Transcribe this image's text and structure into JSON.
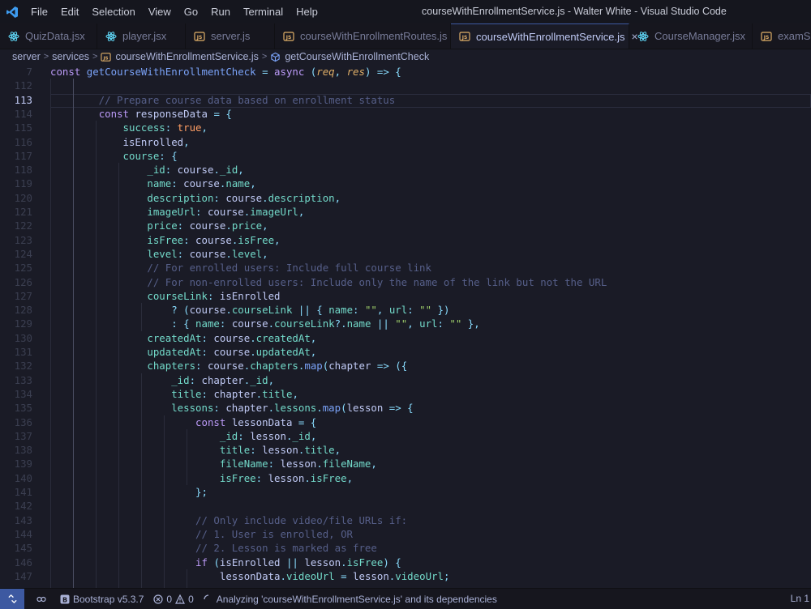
{
  "menu": [
    "File",
    "Edit",
    "Selection",
    "View",
    "Go",
    "Run",
    "Terminal",
    "Help"
  ],
  "window_title": "courseWithEnrollmentService.js - Walter White - Visual Studio Code",
  "tabs": [
    {
      "label": "QuizData.jsx",
      "icon": "react-icon",
      "active": false
    },
    {
      "label": "player.jsx",
      "icon": "react-icon",
      "active": false
    },
    {
      "label": "server.js",
      "icon": "js-icon",
      "active": false
    },
    {
      "label": "courseWithEnrollmentRoutes.js",
      "icon": "js-icon",
      "active": false
    },
    {
      "label": "courseWithEnrollmentService.js",
      "icon": "js-icon",
      "active": true
    },
    {
      "label": "CourseManager.jsx",
      "icon": "react-icon",
      "active": false
    },
    {
      "label": "examSe",
      "icon": "js-icon",
      "active": false
    }
  ],
  "tab_close": "×",
  "breadcrumb": {
    "parts": [
      "server",
      "services",
      "courseWithEnrollmentService.js",
      "getCourseWithEnrollmentCheck"
    ],
    "separator": ">"
  },
  "editor": {
    "current_line": "113",
    "lines": [
      {
        "n": "7",
        "tokens": [
          [
            "kw",
            "const "
          ],
          [
            "fn",
            "getCourseWithEnrollmentCheck"
          ],
          [
            "punc",
            " = "
          ],
          [
            "kw",
            "async "
          ],
          [
            "punc",
            "("
          ],
          [
            "param",
            "req"
          ],
          [
            "punc",
            ", "
          ],
          [
            "param",
            "res"
          ],
          [
            "punc",
            ") => {"
          ]
        ]
      },
      {
        "n": "112",
        "tokens": []
      },
      {
        "n": "113",
        "tokens": [
          [
            "cm",
            "        // Prepare course data based on enrollment status"
          ]
        ]
      },
      {
        "n": "114",
        "tokens": [
          [
            "var",
            "        "
          ],
          [
            "kw",
            "const "
          ],
          [
            "var",
            "responseData "
          ],
          [
            "punc",
            "= {"
          ]
        ]
      },
      {
        "n": "115",
        "tokens": [
          [
            "var",
            "            "
          ],
          [
            "prop",
            "success"
          ],
          [
            "punc",
            ": "
          ],
          [
            "bool",
            "true"
          ],
          [
            "punc",
            ","
          ]
        ]
      },
      {
        "n": "116",
        "tokens": [
          [
            "var",
            "            isEnrolled"
          ],
          [
            "punc",
            ","
          ]
        ]
      },
      {
        "n": "117",
        "tokens": [
          [
            "var",
            "            "
          ],
          [
            "prop",
            "course"
          ],
          [
            "punc",
            ": {"
          ]
        ]
      },
      {
        "n": "118",
        "tokens": [
          [
            "var",
            "                "
          ],
          [
            "prop",
            "_id"
          ],
          [
            "punc",
            ": "
          ],
          [
            "var",
            "course"
          ],
          [
            "punc",
            "."
          ],
          [
            "prop",
            "_id"
          ],
          [
            "punc",
            ","
          ]
        ]
      },
      {
        "n": "119",
        "tokens": [
          [
            "var",
            "                "
          ],
          [
            "prop",
            "name"
          ],
          [
            "punc",
            ": "
          ],
          [
            "var",
            "course"
          ],
          [
            "punc",
            "."
          ],
          [
            "prop",
            "name"
          ],
          [
            "punc",
            ","
          ]
        ]
      },
      {
        "n": "120",
        "tokens": [
          [
            "var",
            "                "
          ],
          [
            "prop",
            "description"
          ],
          [
            "punc",
            ": "
          ],
          [
            "var",
            "course"
          ],
          [
            "punc",
            "."
          ],
          [
            "prop",
            "description"
          ],
          [
            "punc",
            ","
          ]
        ]
      },
      {
        "n": "121",
        "tokens": [
          [
            "var",
            "                "
          ],
          [
            "prop",
            "imageUrl"
          ],
          [
            "punc",
            ": "
          ],
          [
            "var",
            "course"
          ],
          [
            "punc",
            "."
          ],
          [
            "prop",
            "imageUrl"
          ],
          [
            "punc",
            ","
          ]
        ]
      },
      {
        "n": "122",
        "tokens": [
          [
            "var",
            "                "
          ],
          [
            "prop",
            "price"
          ],
          [
            "punc",
            ": "
          ],
          [
            "var",
            "course"
          ],
          [
            "punc",
            "."
          ],
          [
            "prop",
            "price"
          ],
          [
            "punc",
            ","
          ]
        ]
      },
      {
        "n": "123",
        "tokens": [
          [
            "var",
            "                "
          ],
          [
            "prop",
            "isFree"
          ],
          [
            "punc",
            ": "
          ],
          [
            "var",
            "course"
          ],
          [
            "punc",
            "."
          ],
          [
            "prop",
            "isFree"
          ],
          [
            "punc",
            ","
          ]
        ]
      },
      {
        "n": "124",
        "tokens": [
          [
            "var",
            "                "
          ],
          [
            "prop",
            "level"
          ],
          [
            "punc",
            ": "
          ],
          [
            "var",
            "course"
          ],
          [
            "punc",
            "."
          ],
          [
            "prop",
            "level"
          ],
          [
            "punc",
            ","
          ]
        ]
      },
      {
        "n": "125",
        "tokens": [
          [
            "cm",
            "                // For enrolled users: Include full course link"
          ]
        ]
      },
      {
        "n": "126",
        "tokens": [
          [
            "cm",
            "                // For non-enrolled users: Include only the name of the link but not the URL"
          ]
        ]
      },
      {
        "n": "127",
        "tokens": [
          [
            "var",
            "                "
          ],
          [
            "prop",
            "courseLink"
          ],
          [
            "punc",
            ": "
          ],
          [
            "var",
            "isEnrolled"
          ]
        ]
      },
      {
        "n": "128",
        "tokens": [
          [
            "var",
            "                    "
          ],
          [
            "punc",
            "? ("
          ],
          [
            "var",
            "course"
          ],
          [
            "punc",
            "."
          ],
          [
            "prop",
            "courseLink"
          ],
          [
            "punc",
            " || { "
          ],
          [
            "prop",
            "name"
          ],
          [
            "punc",
            ": "
          ],
          [
            "str",
            "\"\""
          ],
          [
            "punc",
            ", "
          ],
          [
            "prop",
            "url"
          ],
          [
            "punc",
            ": "
          ],
          [
            "str",
            "\"\""
          ],
          [
            "punc",
            " })"
          ]
        ]
      },
      {
        "n": "129",
        "tokens": [
          [
            "var",
            "                    "
          ],
          [
            "punc",
            ": { "
          ],
          [
            "prop",
            "name"
          ],
          [
            "punc",
            ": "
          ],
          [
            "var",
            "course"
          ],
          [
            "punc",
            "."
          ],
          [
            "prop",
            "courseLink"
          ],
          [
            "punc",
            "?."
          ],
          [
            "prop",
            "name"
          ],
          [
            "punc",
            " || "
          ],
          [
            "str",
            "\"\""
          ],
          [
            "punc",
            ", "
          ],
          [
            "prop",
            "url"
          ],
          [
            "punc",
            ": "
          ],
          [
            "str",
            "\"\""
          ],
          [
            "punc",
            " },"
          ]
        ]
      },
      {
        "n": "130",
        "tokens": [
          [
            "var",
            "                "
          ],
          [
            "prop",
            "createdAt"
          ],
          [
            "punc",
            ": "
          ],
          [
            "var",
            "course"
          ],
          [
            "punc",
            "."
          ],
          [
            "prop",
            "createdAt"
          ],
          [
            "punc",
            ","
          ]
        ]
      },
      {
        "n": "131",
        "tokens": [
          [
            "var",
            "                "
          ],
          [
            "prop",
            "updatedAt"
          ],
          [
            "punc",
            ": "
          ],
          [
            "var",
            "course"
          ],
          [
            "punc",
            "."
          ],
          [
            "prop",
            "updatedAt"
          ],
          [
            "punc",
            ","
          ]
        ]
      },
      {
        "n": "132",
        "tokens": [
          [
            "var",
            "                "
          ],
          [
            "prop",
            "chapters"
          ],
          [
            "punc",
            ": "
          ],
          [
            "var",
            "course"
          ],
          [
            "punc",
            "."
          ],
          [
            "prop",
            "chapters"
          ],
          [
            "punc",
            "."
          ],
          [
            "fn",
            "map"
          ],
          [
            "punc",
            "("
          ],
          [
            "var",
            "chapter"
          ],
          [
            "punc",
            " => ({"
          ]
        ]
      },
      {
        "n": "133",
        "tokens": [
          [
            "var",
            "                    "
          ],
          [
            "prop",
            "_id"
          ],
          [
            "punc",
            ": "
          ],
          [
            "var",
            "chapter"
          ],
          [
            "punc",
            "."
          ],
          [
            "prop",
            "_id"
          ],
          [
            "punc",
            ","
          ]
        ]
      },
      {
        "n": "134",
        "tokens": [
          [
            "var",
            "                    "
          ],
          [
            "prop",
            "title"
          ],
          [
            "punc",
            ": "
          ],
          [
            "var",
            "chapter"
          ],
          [
            "punc",
            "."
          ],
          [
            "prop",
            "title"
          ],
          [
            "punc",
            ","
          ]
        ]
      },
      {
        "n": "135",
        "tokens": [
          [
            "var",
            "                    "
          ],
          [
            "prop",
            "lessons"
          ],
          [
            "punc",
            ": "
          ],
          [
            "var",
            "chapter"
          ],
          [
            "punc",
            "."
          ],
          [
            "prop",
            "lessons"
          ],
          [
            "punc",
            "."
          ],
          [
            "fn",
            "map"
          ],
          [
            "punc",
            "("
          ],
          [
            "var",
            "lesson"
          ],
          [
            "punc",
            " => {"
          ]
        ]
      },
      {
        "n": "136",
        "tokens": [
          [
            "var",
            "                        "
          ],
          [
            "kw",
            "const "
          ],
          [
            "var",
            "lessonData "
          ],
          [
            "punc",
            "= {"
          ]
        ]
      },
      {
        "n": "137",
        "tokens": [
          [
            "var",
            "                            "
          ],
          [
            "prop",
            "_id"
          ],
          [
            "punc",
            ": "
          ],
          [
            "var",
            "lesson"
          ],
          [
            "punc",
            "."
          ],
          [
            "prop",
            "_id"
          ],
          [
            "punc",
            ","
          ]
        ]
      },
      {
        "n": "138",
        "tokens": [
          [
            "var",
            "                            "
          ],
          [
            "prop",
            "title"
          ],
          [
            "punc",
            ": "
          ],
          [
            "var",
            "lesson"
          ],
          [
            "punc",
            "."
          ],
          [
            "prop",
            "title"
          ],
          [
            "punc",
            ","
          ]
        ]
      },
      {
        "n": "139",
        "tokens": [
          [
            "var",
            "                            "
          ],
          [
            "prop",
            "fileName"
          ],
          [
            "punc",
            ": "
          ],
          [
            "var",
            "lesson"
          ],
          [
            "punc",
            "."
          ],
          [
            "prop",
            "fileName"
          ],
          [
            "punc",
            ","
          ]
        ]
      },
      {
        "n": "140",
        "tokens": [
          [
            "var",
            "                            "
          ],
          [
            "prop",
            "isFree"
          ],
          [
            "punc",
            ": "
          ],
          [
            "var",
            "lesson"
          ],
          [
            "punc",
            "."
          ],
          [
            "prop",
            "isFree"
          ],
          [
            "punc",
            ","
          ]
        ]
      },
      {
        "n": "141",
        "tokens": [
          [
            "var",
            "                        "
          ],
          [
            "punc",
            "};"
          ]
        ]
      },
      {
        "n": "142",
        "tokens": []
      },
      {
        "n": "143",
        "tokens": [
          [
            "cm",
            "                        // Only include video/file URLs if:"
          ]
        ]
      },
      {
        "n": "144",
        "tokens": [
          [
            "cm",
            "                        // 1. User is enrolled, OR"
          ]
        ]
      },
      {
        "n": "145",
        "tokens": [
          [
            "cm",
            "                        // 2. Lesson is marked as free"
          ]
        ]
      },
      {
        "n": "146",
        "tokens": [
          [
            "var",
            "                        "
          ],
          [
            "kw",
            "if "
          ],
          [
            "punc",
            "("
          ],
          [
            "var",
            "isEnrolled"
          ],
          [
            "punc",
            " || "
          ],
          [
            "var",
            "lesson"
          ],
          [
            "punc",
            "."
          ],
          [
            "prop",
            "isFree"
          ],
          [
            "punc",
            ") {"
          ]
        ]
      },
      {
        "n": "147",
        "tokens": [
          [
            "var",
            "                            lessonData"
          ],
          [
            "punc",
            "."
          ],
          [
            "prop",
            "videoUrl"
          ],
          [
            "punc",
            " = "
          ],
          [
            "var",
            "lesson"
          ],
          [
            "punc",
            "."
          ],
          [
            "prop",
            "videoUrl"
          ],
          [
            "punc",
            ";"
          ]
        ]
      }
    ]
  },
  "status": {
    "bootstrap": "Bootstrap v5.3.7",
    "errors": "0",
    "warnings": "0",
    "analyzing": "Analyzing 'courseWithEnrollmentService.js' and its dependencies",
    "position": "Ln 1"
  }
}
